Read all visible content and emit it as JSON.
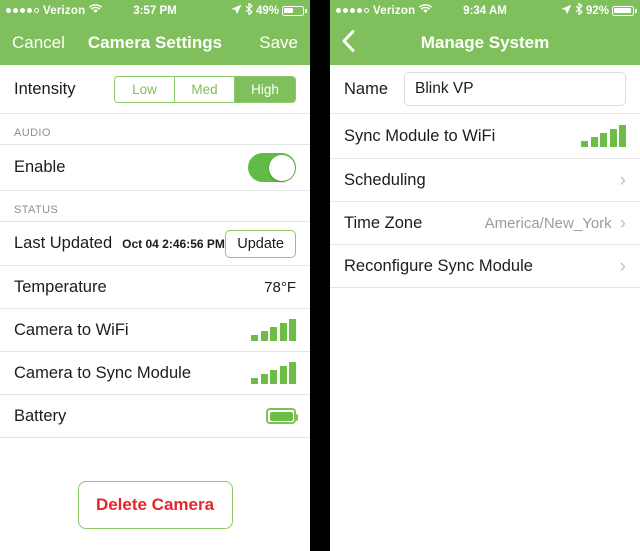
{
  "left": {
    "statusbar": {
      "carrier": "Verizon",
      "signal_dots_filled": 4,
      "signal_dots_total": 5,
      "wifi_icon": "wifi-icon",
      "time": "3:57 PM",
      "location_icon": "location-arrow-icon",
      "bluetooth_icon": "bluetooth-icon",
      "battery_percent": "49%",
      "battery_level": 49
    },
    "navbar": {
      "cancel_label": "Cancel",
      "title": "Camera Settings",
      "save_label": "Save"
    },
    "intensity": {
      "label": "Intensity",
      "options": [
        "Low",
        "Med",
        "High"
      ],
      "selected": "High"
    },
    "audio": {
      "section_title": "AUDIO",
      "enable_label": "Enable",
      "enable_on": true
    },
    "status": {
      "section_title": "STATUS",
      "last_updated_label": "Last Updated",
      "last_updated_value": "Oct 04 2:46:56 PM",
      "update_button": "Update",
      "temperature_label": "Temperature",
      "temperature_value": "78°F",
      "camera_wifi_label": "Camera to WiFi",
      "camera_wifi_bars": 5,
      "camera_sync_label": "Camera to Sync Module",
      "camera_sync_bars": 5,
      "battery_label": "Battery",
      "battery_icon": "battery-full-icon"
    },
    "delete_button": "Delete Camera"
  },
  "right": {
    "statusbar": {
      "carrier": "Verizon",
      "signal_dots_filled": 4,
      "signal_dots_total": 5,
      "wifi_icon": "wifi-icon",
      "time": "9:34 AM",
      "location_icon": "location-arrow-icon",
      "bluetooth_icon": "bluetooth-icon",
      "battery_percent": "92%",
      "battery_level": 92
    },
    "navbar": {
      "back_icon": "chevron-left-icon",
      "title": "Manage System"
    },
    "rows": {
      "name_label": "Name",
      "name_value": "Blink VP",
      "sync_wifi_label": "Sync Module to WiFi",
      "sync_wifi_bars": 5,
      "scheduling_label": "Scheduling",
      "timezone_label": "Time Zone",
      "timezone_value": "America/New_York",
      "reconfigure_label": "Reconfigure Sync Module"
    }
  },
  "colors": {
    "brand_green": "#7fc05c",
    "bar_green": "#6cbd45",
    "delete_red": "#e8252a",
    "muted_gray": "#8e8e93"
  }
}
